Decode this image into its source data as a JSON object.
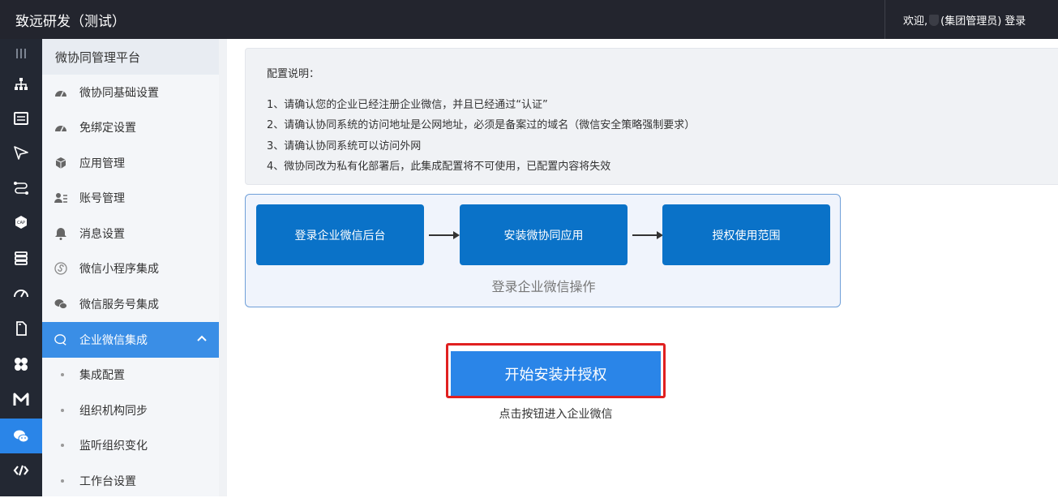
{
  "header": {
    "brand": "致远研发（测试）",
    "welcome": "欢迎,",
    "role": "(集团管理员)",
    "login": "登录"
  },
  "rail": {
    "items": [
      {
        "icon": "menu-lines-icon"
      },
      {
        "icon": "org-chart-icon"
      },
      {
        "icon": "form-icon"
      },
      {
        "icon": "send-icon"
      },
      {
        "icon": "workflow-icon"
      },
      {
        "icon": "cap-icon"
      },
      {
        "icon": "database-icon"
      },
      {
        "icon": "dashboard-icon"
      },
      {
        "icon": "document-icon"
      },
      {
        "icon": "apps-icon"
      },
      {
        "icon": "m-icon"
      },
      {
        "icon": "wechat-icon",
        "active": true
      },
      {
        "icon": "code-icon"
      }
    ]
  },
  "sidebar": {
    "title": "微协同管理平台",
    "items": [
      {
        "label": "微协同基础设置",
        "icon": "gauge-icon"
      },
      {
        "label": "免绑定设置",
        "icon": "gauge-icon"
      },
      {
        "label": "应用管理",
        "icon": "cube-icon"
      },
      {
        "label": "账号管理",
        "icon": "user-card-icon"
      },
      {
        "label": "消息设置",
        "icon": "bell-icon"
      },
      {
        "label": "微信小程序集成",
        "icon": "miniprogram-icon"
      },
      {
        "label": "微信服务号集成",
        "icon": "wechat-icon"
      },
      {
        "label": "企业微信集成",
        "icon": "chat-bubble-icon",
        "active": true
      }
    ],
    "subitems": [
      {
        "label": "集成配置"
      },
      {
        "label": "组织机构同步"
      },
      {
        "label": "监听组织变化"
      },
      {
        "label": "工作台设置"
      }
    ]
  },
  "notice": {
    "title": "配置说明：",
    "lines": [
      "1、请确认您的企业已经注册企业微信，并且已经通过“认证”",
      "2、请确认协同系统的访问地址是公网地址，必须是备案过的域名（微信安全策略强制要求）",
      "3、请确认协同系统可以访问外网",
      "4、微协同改为私有化部署后，此集成配置将不可使用，已配置内容将失效"
    ]
  },
  "flow": {
    "steps": [
      "登录企业微信后台",
      "安装微协同应用",
      "授权使用范围"
    ],
    "caption": "登录企业微信操作"
  },
  "cta": {
    "label": "开始安装并授权",
    "hint": "点击按钮进入企业微信"
  },
  "colors": {
    "topbar": "#23252e",
    "rail": "#232833",
    "accent": "#2a85e8",
    "step": "#0a72c8",
    "highlight": "#e02020"
  }
}
